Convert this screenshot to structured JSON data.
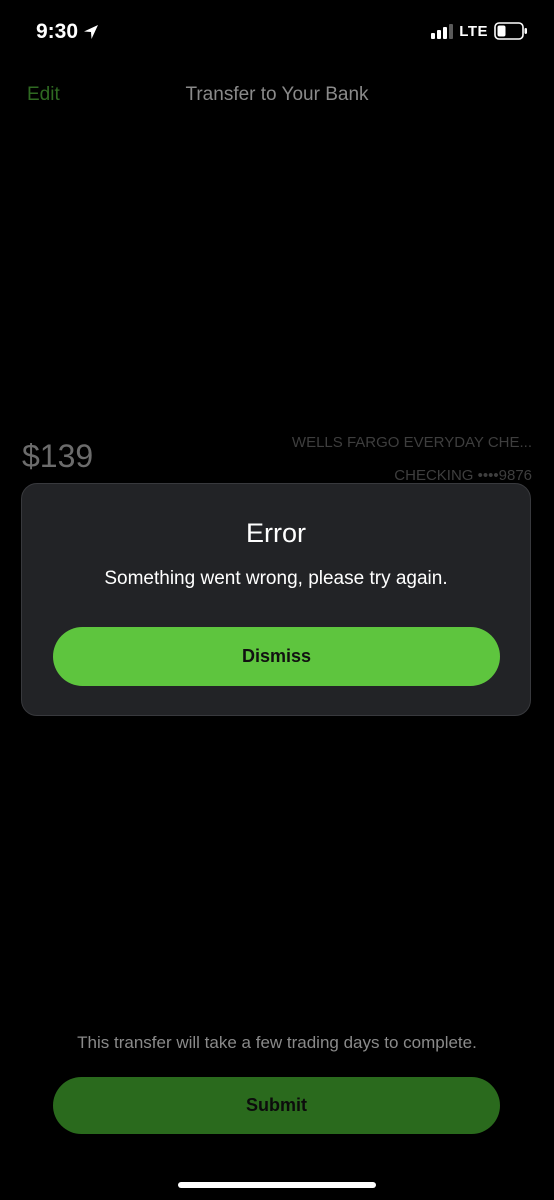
{
  "status_bar": {
    "time": "9:30",
    "network": "LTE",
    "icons": [
      "location-arrow-icon",
      "signal-bars-icon",
      "battery-icon"
    ]
  },
  "nav": {
    "edit_label": "Edit",
    "title": "Transfer to Your Bank"
  },
  "transfer": {
    "amount": "$139",
    "bank_name": "WELLS FARGO EVERYDAY CHE...",
    "account": "CHECKING ••••9876"
  },
  "modal": {
    "title": "Error",
    "message": "Something went wrong, please try again.",
    "dismiss_label": "Dismiss"
  },
  "footer": {
    "note": "This transfer will take a few trading days to complete.",
    "submit_label": "Submit"
  },
  "colors": {
    "accent_green": "#5ec53e",
    "dim_green": "#2a6a1d",
    "modal_bg": "#222326",
    "background": "#000000"
  }
}
